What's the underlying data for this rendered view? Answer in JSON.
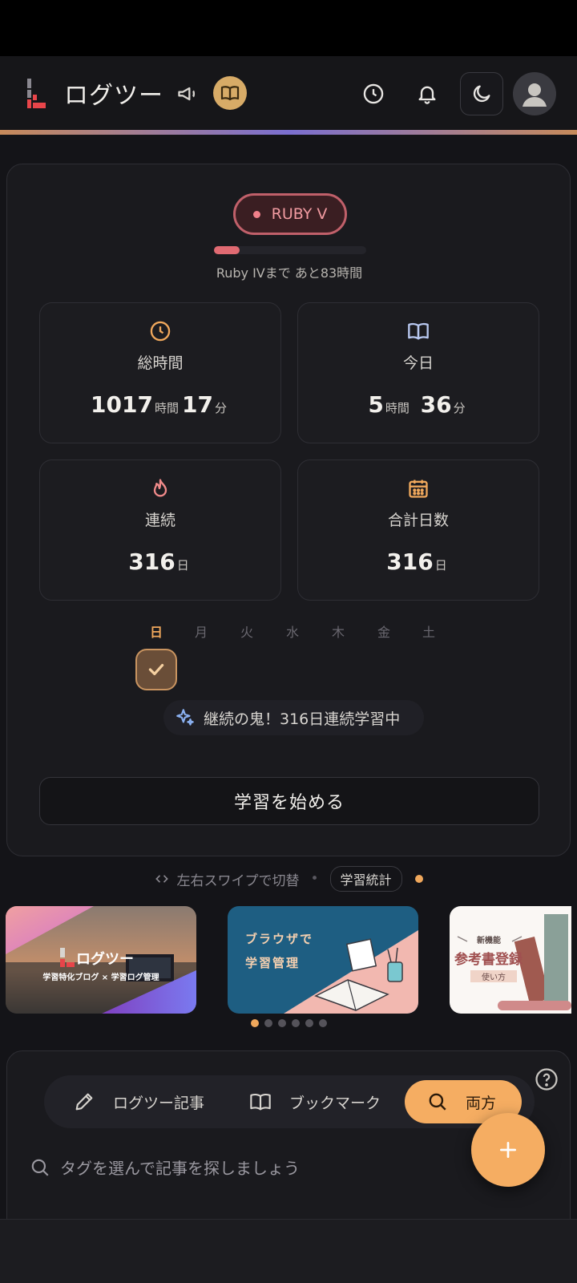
{
  "header": {
    "app_title": "ログツー"
  },
  "rank": {
    "name": "RUBY V",
    "progress": 0.17,
    "next_text": "Ruby IVまで あと83時間"
  },
  "stats": {
    "total": {
      "label": "総時間",
      "hours": "1017",
      "hours_unit": "時間",
      "minutes": "17",
      "minutes_unit": "分"
    },
    "today": {
      "label": "今日",
      "hours": "5",
      "hours_unit": "時間",
      "minutes": "36",
      "minutes_unit": "分"
    },
    "streak": {
      "label": "連続",
      "value": "316",
      "unit": "日"
    },
    "total_days": {
      "label": "合計日数",
      "value": "316",
      "unit": "日"
    }
  },
  "week": {
    "days": [
      "日",
      "月",
      "火",
      "水",
      "木",
      "金",
      "土"
    ],
    "today_index": 0,
    "checked": [
      true,
      false,
      false,
      false,
      false,
      false,
      false
    ]
  },
  "streak_message": "継続の鬼！316日連続学習中",
  "start_button": "学習を始める",
  "swipe": {
    "hint": "左右スワイプで切替",
    "separator": "•",
    "chip": "学習統計"
  },
  "banners": [
    {
      "title": "ログツー",
      "subtitle": "学習特化ブログ × 学習ログ管理"
    },
    {
      "line1": "ブラウザで",
      "line2": "学習管理"
    },
    {
      "tag": "新機能",
      "title": "参考書登録",
      "sub": "使い方"
    }
  ],
  "banner_pager": {
    "count": 6,
    "active": 0
  },
  "tabs": [
    {
      "label": "ログツー記事",
      "icon": "pencil-icon"
    },
    {
      "label": "ブックマーク",
      "icon": "book-open-icon"
    },
    {
      "label": "両方",
      "icon": "search-icon",
      "active": true
    }
  ],
  "tag_search_placeholder": "タグを選んで記事を探しましょう",
  "colors": {
    "accent": "#f5ad62",
    "ruby": "#e06a72",
    "background": "#141418"
  }
}
